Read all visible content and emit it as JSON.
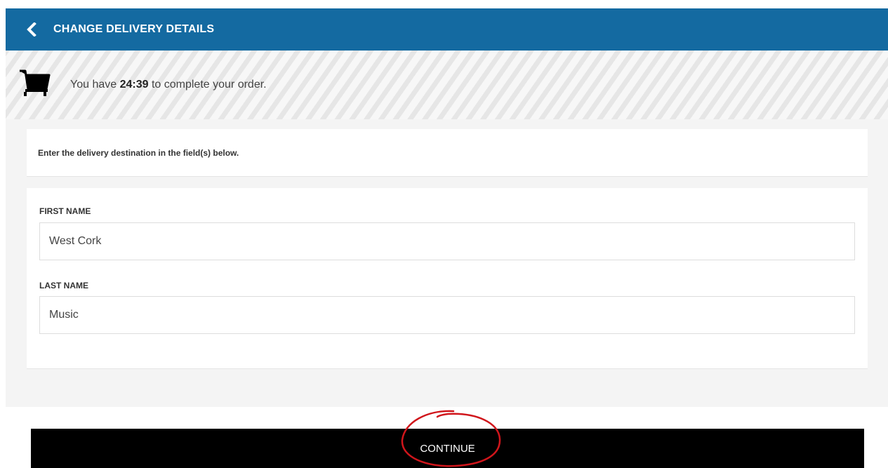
{
  "header": {
    "title": "CHANGE DELIVERY DETAILS",
    "back_icon": "chevron-left-icon",
    "background_color": "#146aa1"
  },
  "timer": {
    "prefix": "You have ",
    "time_remaining": "24:39",
    "suffix": " to complete your order.",
    "icon": "shopping-cart-icon"
  },
  "instructions": {
    "text": "Enter the delivery destination in the field(s) below."
  },
  "form": {
    "first_name": {
      "label": "FIRST NAME",
      "value": "West Cork"
    },
    "last_name": {
      "label": "LAST NAME",
      "value": "Music"
    }
  },
  "continue_button": {
    "label": "CONTINUE",
    "background_color": "#000000"
  },
  "annotation": {
    "color": "#d0151b"
  }
}
